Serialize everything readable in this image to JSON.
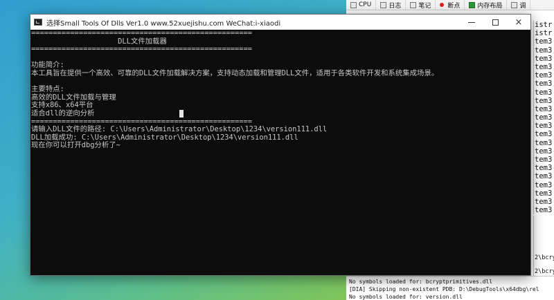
{
  "console_window": {
    "title": "选择Small Tools Of Dlls Ver1.0  www.52xuejishu.com  WeChat:i-xiaodi",
    "buttons": {
      "minimize": "minimize",
      "maximize": "maximize",
      "close": "×"
    },
    "lines": [
      "===================================================",
      "                    DLL文件加载器",
      "===================================================",
      "",
      "功能简介:",
      "本工具旨在提供一个高效、可靠的DLL文件加载解决方案，支持动态加载和管理DLL文件，适用于各类软件开发和系统集成场景。",
      "",
      "主要特点:",
      "高效的DLL文件加载与管理",
      "支持x86、x64平台",
      "适合dll的逆向分析",
      "===================================================",
      "请输入DLL文件的路径: C:\\Users\\Administrator\\Desktop\\1234\\version111.dll",
      "DLL加载成功: C:\\Users\\Administrator\\Desktop\\1234\\version111.dll",
      "现在你可以打开dbg分析了~"
    ]
  },
  "debugger": {
    "toolbar": [
      "CPU",
      "日志",
      "笔记",
      "断点",
      "内存布局",
      "调"
    ],
    "list_rows": [
      "istr",
      "istr",
      "tem3",
      "tem3",
      "tem3",
      "tem3",
      "tem3",
      "tem3",
      "tem3",
      "tem3",
      "tem3",
      "tem3",
      "tem3",
      "tem3",
      "tem3",
      "tem3",
      "tem3",
      "tem3",
      "tem3",
      "tem3",
      "tem3",
      "tem3",
      "tem3"
    ],
    "side_text": [
      "2\\bcry",
      "2\\bcry"
    ],
    "log_lines": [
      "No symbols loaded for: bcryptprimitives.dll",
      "[DIA] Skipping non-existent PDB: D:\\DebugTools\\x64dbg\\rel",
      "No symbols loaded for: version.dll"
    ]
  }
}
